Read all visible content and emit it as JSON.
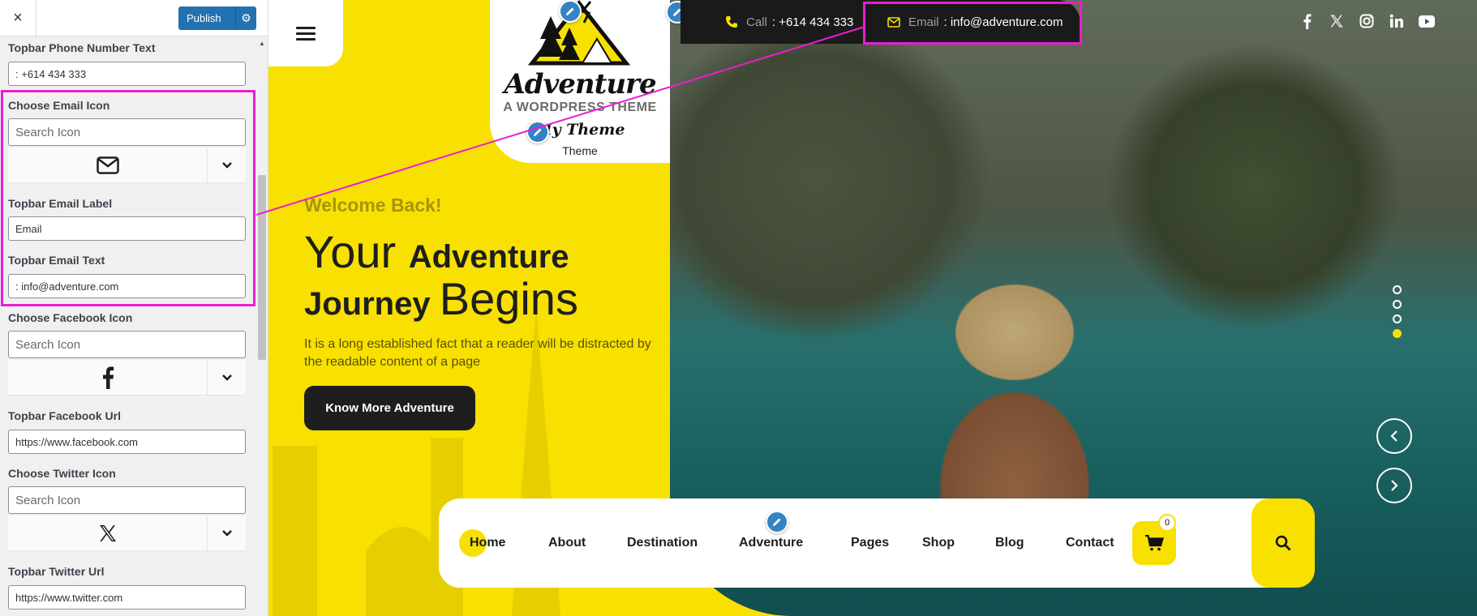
{
  "customizer": {
    "close_label": "×",
    "publish_label": "Publish",
    "controls": {
      "phone_text_label": "Topbar Phone Number Text",
      "phone_text_value": ": +614 434 333",
      "email_icon_label": "Choose Email Icon",
      "email_icon_search_placeholder": "Search Icon",
      "email_label_label": "Topbar Email Label",
      "email_label_value": "Email",
      "email_text_label": "Topbar Email Text",
      "email_text_value": ": info@adventure.com",
      "facebook_icon_label": "Choose Facebook Icon",
      "facebook_icon_search_placeholder": "Search Icon",
      "facebook_url_label": "Topbar Facebook Url",
      "facebook_url_value": "https://www.facebook.com",
      "twitter_icon_label": "Choose Twitter Icon",
      "twitter_icon_search_placeholder": "Search Icon",
      "twitter_url_label": "Topbar Twitter Url",
      "twitter_url_value": "https://www.twitter.com"
    },
    "icons": {
      "email": "envelope-icon",
      "facebook": "facebook-icon",
      "twitter": "x-twitter-icon"
    }
  },
  "preview": {
    "logo": {
      "title": "Adventure",
      "tagline": "A WORDPRESS THEME"
    },
    "site_title": "My Theme",
    "site_tagline": "Theme",
    "topbar": {
      "call_label": "Call",
      "call_value": ": +614 434 333",
      "email_label": "Email",
      "email_value": ": info@adventure.com"
    },
    "social_icons": [
      "facebook-icon",
      "x-twitter-icon",
      "instagram-icon",
      "linkedin-icon",
      "youtube-icon"
    ],
    "hero": {
      "welcome": "Welcome Back!",
      "line1_thin": "Your ",
      "line1_bold": "Adventure",
      "line2_bold": "Journey ",
      "line2_thin": "Begins",
      "text": "It is a long established fact that a reader will be distracted by the readable content of a page",
      "button": "Know More Adventure"
    },
    "slider": {
      "slide_count": 4,
      "active_slide": 4
    },
    "nav": {
      "items": [
        "Home",
        "About",
        "Destination",
        "Adventure",
        "Pages",
        "Shop",
        "Blog",
        "Contact"
      ],
      "active": "Home",
      "cart_count": "0"
    },
    "colors": {
      "brand_yellow": "#f8e000",
      "dark": "#1e1e1e",
      "highlight": "#e91ed0",
      "wp_blue": "#2271b1"
    }
  }
}
